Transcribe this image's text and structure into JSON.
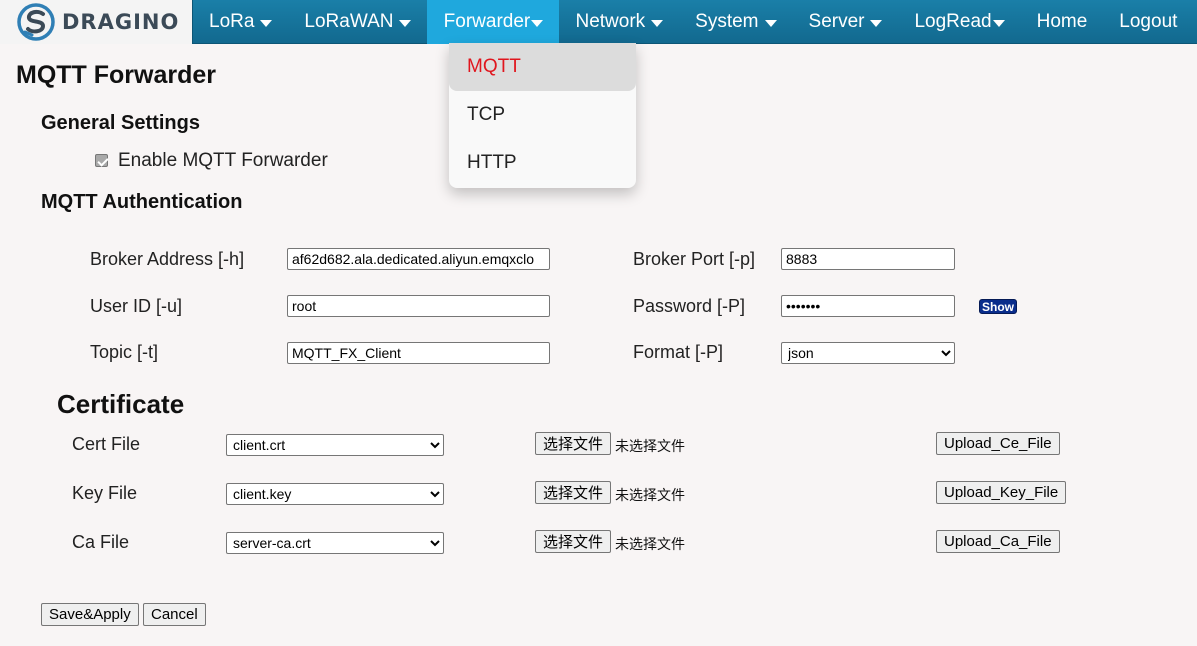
{
  "brand": {
    "name": "DRAGINO"
  },
  "nav": {
    "items": [
      {
        "label": "LoRa",
        "dropdown": true
      },
      {
        "label": "LoRaWAN",
        "dropdown": true
      },
      {
        "label": "Forwarder",
        "dropdown": true,
        "active": true
      },
      {
        "label": "Network",
        "dropdown": true
      },
      {
        "label": "System",
        "dropdown": true
      },
      {
        "label": "Server",
        "dropdown": true
      },
      {
        "label": "LogRead",
        "dropdown": true
      },
      {
        "label": "Home",
        "dropdown": false
      },
      {
        "label": "Logout",
        "dropdown": false
      }
    ]
  },
  "forwarder_menu": {
    "items": [
      {
        "label": "MQTT",
        "selected": true
      },
      {
        "label": "TCP"
      },
      {
        "label": "HTTP"
      }
    ]
  },
  "page": {
    "title": "MQTT Forwarder",
    "general_heading": "General Settings",
    "enable_label": "Enable MQTT Forwarder",
    "enable_checked": true,
    "auth_heading": "MQTT Authentication"
  },
  "auth": {
    "broker_address": {
      "label": "Broker Address [-h]",
      "value": "af62d682.ala.dedicated.aliyun.emqxclo"
    },
    "broker_port": {
      "label": "Broker Port [-p]",
      "value": "8883"
    },
    "user_id": {
      "label": "User ID [-u]",
      "value": "root"
    },
    "password": {
      "label": "Password [-P]",
      "value": "•••••••"
    },
    "show_label": "Show",
    "topic": {
      "label": "Topic [-t]",
      "value": "MQTT_FX_Client"
    },
    "format": {
      "label": "Format [-P]",
      "value": "json"
    }
  },
  "certificate": {
    "heading": "Certificate",
    "choose_label": "选择文件",
    "no_file_label": "未选择文件",
    "rows": [
      {
        "label": "Cert File",
        "value": "client.crt",
        "upload": "Upload_Ce_File"
      },
      {
        "label": "Key File",
        "value": "client.key",
        "upload": "Upload_Key_File"
      },
      {
        "label": "Ca File",
        "value": "server-ca.crt",
        "upload": "Upload_Ca_File"
      }
    ]
  },
  "actions": {
    "save": "Save&Apply",
    "cancel": "Cancel"
  },
  "colors": {
    "nav_bg": "#1a7fa8",
    "nav_active": "#1fa8dd",
    "menu_selected_text": "#e0161e",
    "show_button": "#0a2d8c"
  }
}
